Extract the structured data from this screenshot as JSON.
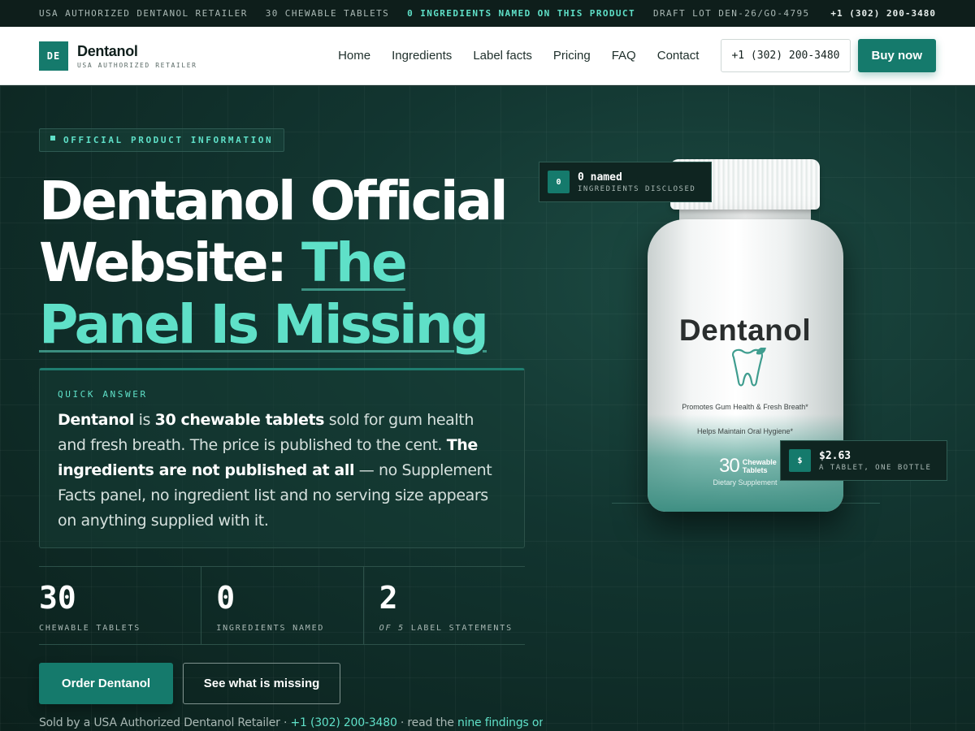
{
  "topbar": {
    "retailer": "USA AUTHORIZED DENTANOL RETAILER",
    "tablets": "30 CHEWABLE TABLETS",
    "ingredients": "0 INGREDIENTS NAMED ON THIS PRODUCT",
    "lot": "DRAFT LOT DEN-26/GO-4795",
    "phone": "+1 (302) 200-3480"
  },
  "nav": {
    "logo_initials": "DE",
    "brand_name": "Dentanol",
    "brand_sub": "USA AUTHORIZED RETAILER",
    "links": [
      "Home",
      "Ingredients",
      "Label facts",
      "Pricing",
      "FAQ",
      "Contact"
    ],
    "phone": "+1 (302) 200-3480",
    "buy": "Buy now"
  },
  "hero": {
    "badge": "OFFICIAL PRODUCT INFORMATION",
    "title_plain": "Dentanol Official Website: ",
    "title_accent": "The Panel Is Missing",
    "quick_label": "QUICK ANSWER",
    "quick": {
      "p1b": "Dentanol",
      "p2": " is ",
      "p3b": "30 chewable tablets",
      "p4": " sold for gum health and fresh breath. The price is published to the cent. ",
      "p5b": "The ingredients are not published at all",
      "p6": " — no Supplement Facts panel, no ingredient list and no serving size appears on anything supplied with it."
    },
    "stats": [
      {
        "num": "30",
        "label": "CHEWABLE TABLETS"
      },
      {
        "num": "0",
        "label": "INGREDIENTS NAMED"
      },
      {
        "num": "2",
        "label_em": "OF 5",
        "label": " LABEL STATEMENTS"
      }
    ],
    "order_btn": "Order Dentanol",
    "missing_btn": "See what is missing",
    "foot_prefix": "Sold by a USA Authorized Dentanol Retailer · ",
    "foot_phone": "+1 (302) 200-3480",
    "foot_mid": " · read the ",
    "foot_link": "nine findings on"
  },
  "bottle": {
    "brand": "Dentanol",
    "tagline1": "Promotes Gum Health & Fresh Breath*",
    "tagline2": "Helps Maintain Oral Hygiene*",
    "count": "30",
    "count_unit1": "Chewable",
    "count_unit2": "Tablets",
    "supplement": "Dietary Supplement"
  },
  "chips": {
    "ingredients": {
      "icon": "0",
      "value": "0 named",
      "label": "INGREDIENTS DISCLOSED"
    },
    "price": {
      "icon": "$",
      "value": "$2.63",
      "label": "A TABLET, ONE BOTTLE"
    }
  },
  "colors": {
    "accent": "#5fe0c8",
    "brand": "#157a6c",
    "bg": "#0d2420"
  }
}
